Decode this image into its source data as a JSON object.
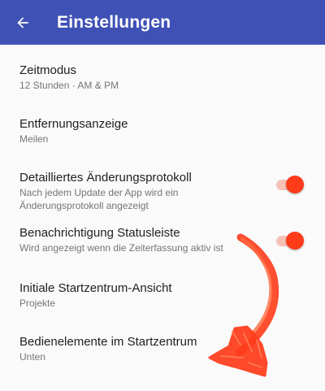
{
  "appbar": {
    "title": "Einstellungen",
    "back_icon": "arrow-back-icon",
    "background": "#3f51b5"
  },
  "settings": [
    {
      "title": "Zeitmodus",
      "subtitle": "12 Stunden · AM & PM",
      "has_switch": false
    },
    {
      "title": "Entfernungsanzeige",
      "subtitle": "Meilen",
      "has_switch": false
    },
    {
      "title": "Detailliertes Änderungsprotokoll",
      "subtitle_line1": "Nach jedem Update der App wird ein",
      "subtitle_line2": "Änderungsprotokoll angezeigt",
      "has_switch": true,
      "switch_on": true
    },
    {
      "title": "Benachrichtigung Statusleiste",
      "subtitle": "Wird angezeigt wenn die Zeiterfassung aktiv ist",
      "has_switch": true,
      "switch_on": true
    },
    {
      "title": "Initiale Startzentrum-Ansicht",
      "subtitle": "Projekte",
      "has_switch": false
    },
    {
      "title": "Bedienelemente im Startzentrum",
      "subtitle": "Unten",
      "has_switch": false
    }
  ],
  "colors": {
    "accent": "#ff3b1a",
    "switch_track": "#f6c2b4",
    "annotation_arrow": "#ff3b1a"
  },
  "annotation": {
    "icon": "hand-drawn-arrow-icon"
  }
}
